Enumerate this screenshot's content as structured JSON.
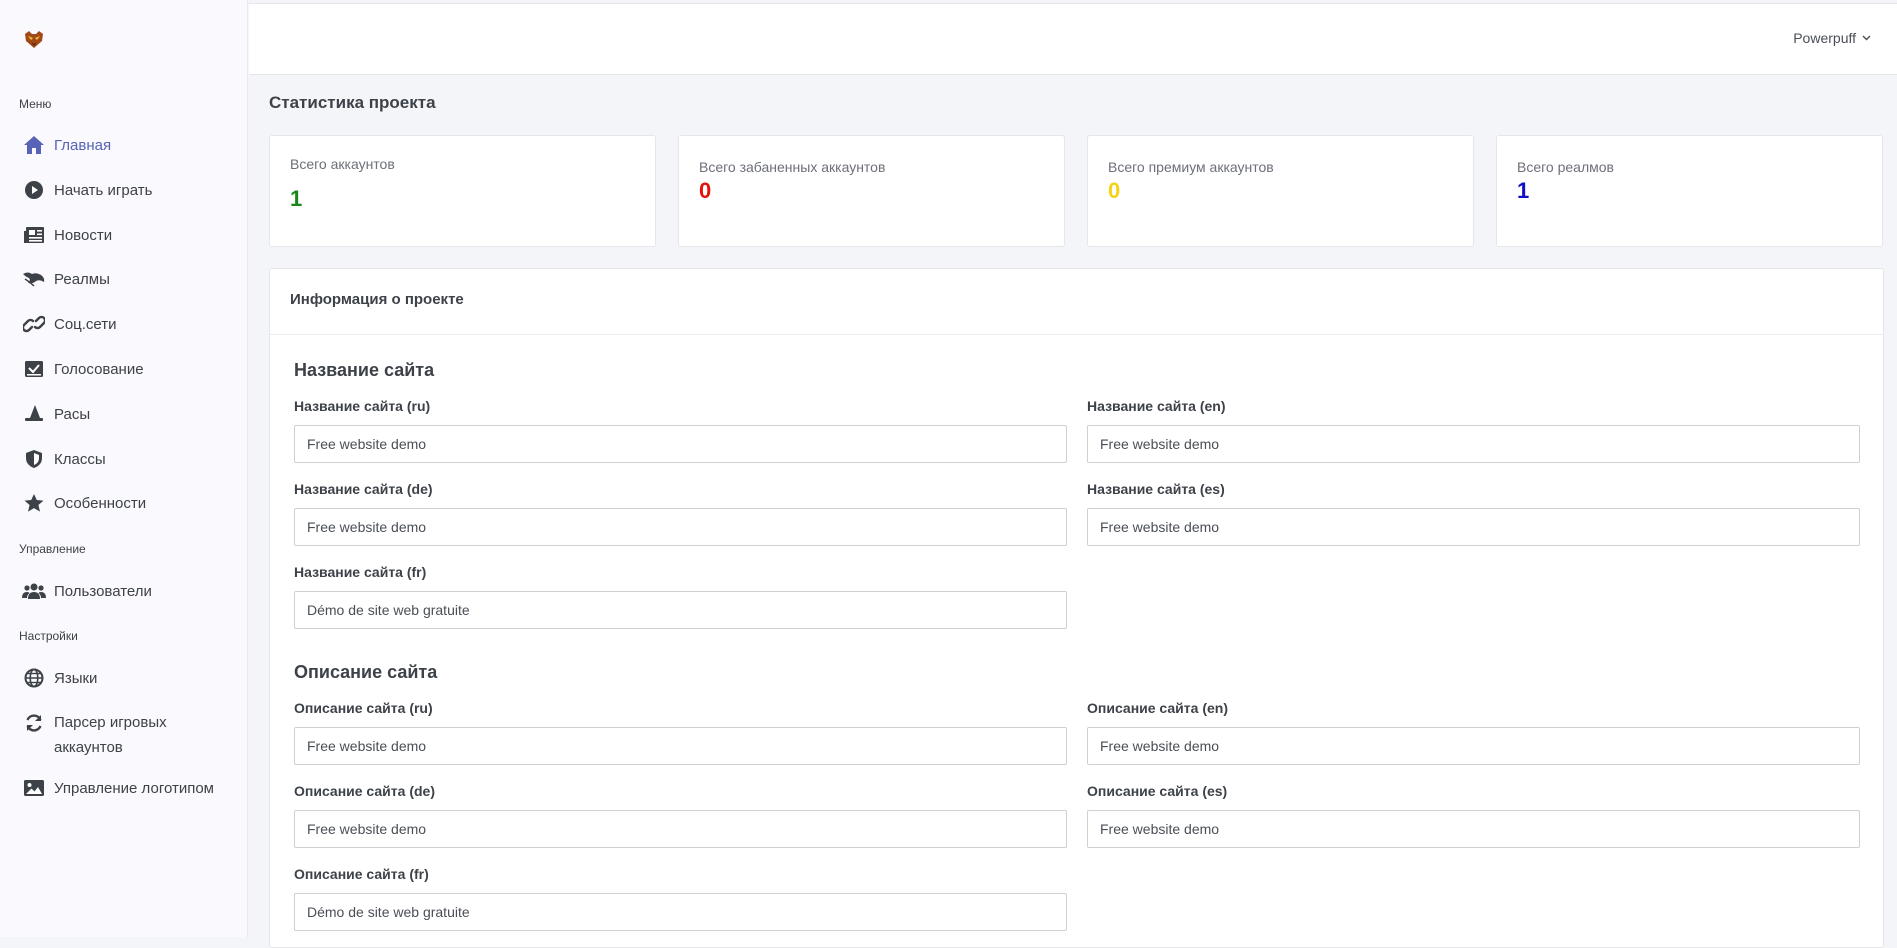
{
  "sidebar": {
    "sections": {
      "menu": "Меню",
      "management": "Управление",
      "settings": "Настройки"
    },
    "items": [
      {
        "label": "Главная",
        "icon": "home-icon"
      },
      {
        "label": "Начать играть",
        "icon": "play-circle-icon"
      },
      {
        "label": "Новости",
        "icon": "newspaper-icon"
      },
      {
        "label": "Реалмы",
        "icon": "dragon-icon"
      },
      {
        "label": "Соц.сети",
        "icon": "link-icon"
      },
      {
        "label": "Голосование",
        "icon": "vote-box-icon"
      },
      {
        "label": "Расы",
        "icon": "wizard-hat-icon"
      },
      {
        "label": "Классы",
        "icon": "shield-icon"
      },
      {
        "label": "Особенности",
        "icon": "star-icon"
      },
      {
        "label": "Пользователи",
        "icon": "users-icon"
      },
      {
        "label": "Языки",
        "icon": "globe-icon"
      },
      {
        "label": "Парсер игровых аккаунтов",
        "icon": "sync-icon"
      },
      {
        "label": "Управление логотипом",
        "icon": "image-icon"
      }
    ]
  },
  "header": {
    "user_name": "Powerpuff"
  },
  "stats": {
    "title": "Статистика проекта",
    "cards": [
      {
        "label": "Всего аккаунтов",
        "value": "1",
        "color": "#198719"
      },
      {
        "label": "Всего забаненных аккаунтов",
        "value": "0",
        "color": "#e3120b"
      },
      {
        "label": "Всего премиум аккаунтов",
        "value": "0",
        "color": "#f2d316"
      },
      {
        "label": "Всего реалмов",
        "value": "1",
        "color": "#1010c8"
      }
    ]
  },
  "project_info": {
    "title": "Информация о проекте",
    "site_name": {
      "title": "Название сайта",
      "fields": [
        {
          "label": "Название сайта (ru)",
          "value": "Free website demo"
        },
        {
          "label": "Название сайта (en)",
          "value": "Free website demo"
        },
        {
          "label": "Название сайта (de)",
          "value": "Free website demo"
        },
        {
          "label": "Название сайта (es)",
          "value": "Free website demo"
        },
        {
          "label": "Название сайта (fr)",
          "value": "Démo de site web gratuite"
        }
      ]
    },
    "site_description": {
      "title": "Описание сайта",
      "fields": [
        {
          "label": "Описание сайта (ru)",
          "value": "Free website demo"
        },
        {
          "label": "Описание сайта (en)",
          "value": "Free website demo"
        },
        {
          "label": "Описание сайта (de)",
          "value": "Free website demo"
        },
        {
          "label": "Описание сайта (es)",
          "value": "Free website demo"
        },
        {
          "label": "Описание сайта (fr)",
          "value": "Démo de site web gratuite"
        }
      ]
    }
  },
  "colors": {
    "accent": "#5763b6",
    "text": "#3d4249"
  }
}
